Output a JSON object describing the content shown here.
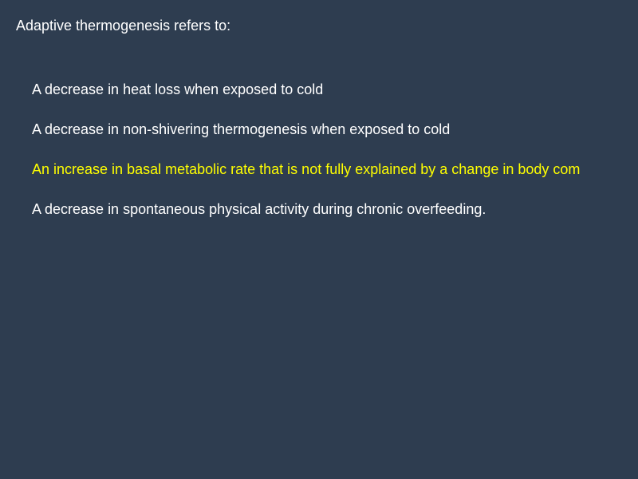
{
  "question": {
    "text": "Adaptive thermogenesis refers to:"
  },
  "options": [
    {
      "text": "A decrease in heat loss when exposed to cold",
      "highlighted": false
    },
    {
      "text": "A decrease in non-shivering thermogenesis when exposed to cold",
      "highlighted": false
    },
    {
      "text": "An increase in basal metabolic rate that is not fully explained by a change in body com",
      "highlighted": true
    },
    {
      "text": "A decrease in spontaneous physical activity during chronic overfeeding.",
      "highlighted": false
    }
  ],
  "colors": {
    "background": "#2e3d50",
    "text": "#ffffff",
    "highlight": "#ffff00"
  }
}
